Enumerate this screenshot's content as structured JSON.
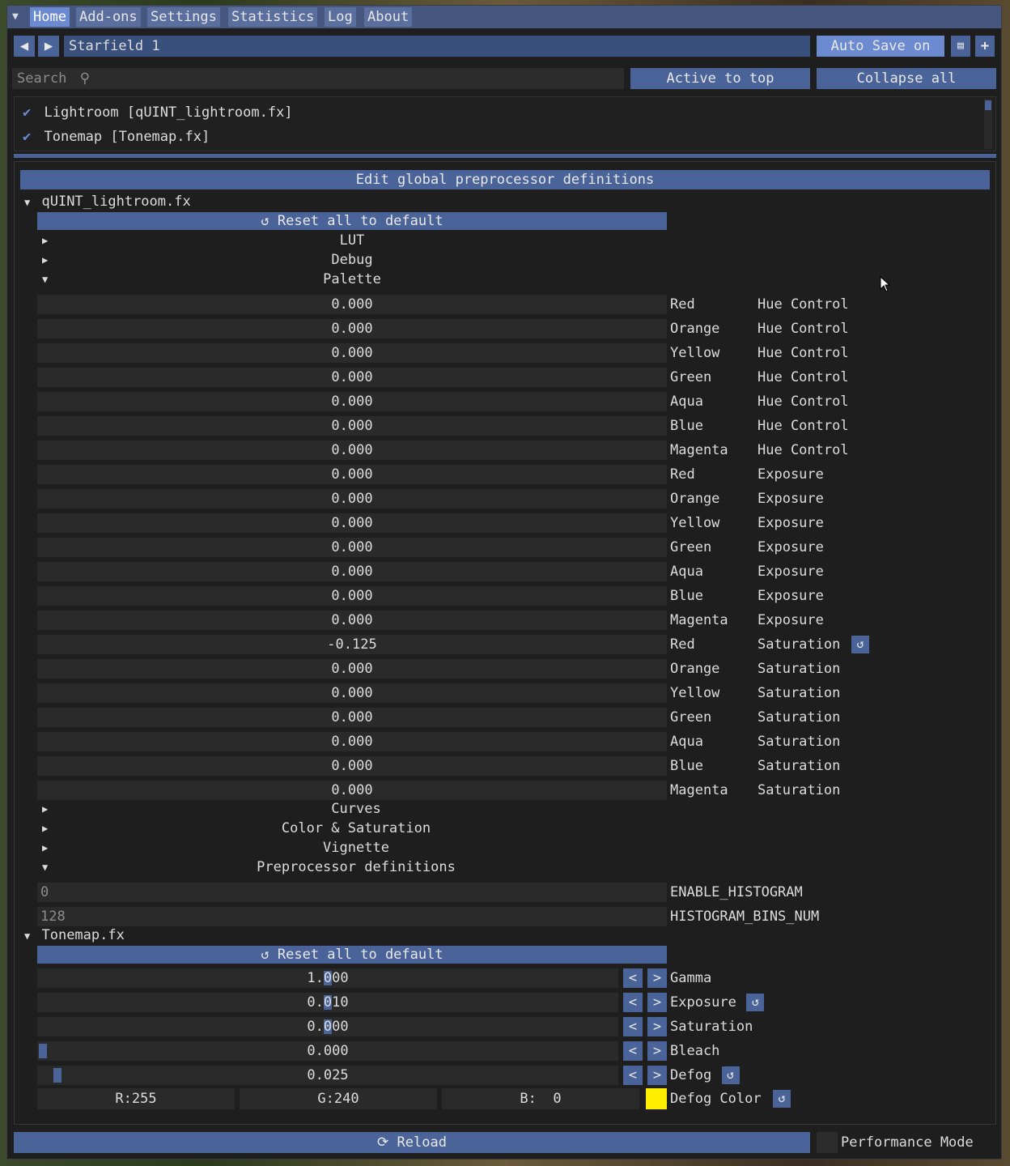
{
  "menu": {
    "items": [
      "Home",
      "Add-ons",
      "Settings",
      "Statistics",
      "Log",
      "About"
    ]
  },
  "toolbar": {
    "preset_name": "Starfield 1",
    "autosave_label": "Auto Save on"
  },
  "search": {
    "placeholder": "Search",
    "active_to_top": "Active to top",
    "collapse_all": "Collapse all"
  },
  "effects": [
    {
      "label": "Lightroom [qUINT_lightroom.fx]",
      "checked": true
    },
    {
      "label": "Tonemap [Tonemap.fx]",
      "checked": true
    }
  ],
  "global_button": "Edit global preprocessor definitions",
  "lightroom": {
    "title": "qUINT_lightroom.fx",
    "reset_label": "Reset all to default",
    "categories_top": [
      "LUT",
      "Debug",
      "Palette"
    ],
    "params": [
      {
        "value": "0.000",
        "a": "Red",
        "b": "Hue Control"
      },
      {
        "value": "0.000",
        "a": "Orange",
        "b": "Hue Control"
      },
      {
        "value": "0.000",
        "a": "Yellow",
        "b": "Hue Control"
      },
      {
        "value": "0.000",
        "a": "Green",
        "b": "Hue Control"
      },
      {
        "value": "0.000",
        "a": "Aqua",
        "b": "Hue Control"
      },
      {
        "value": "0.000",
        "a": "Blue",
        "b": "Hue Control"
      },
      {
        "value": "0.000",
        "a": "Magenta",
        "b": "Hue Control"
      },
      {
        "value": "0.000",
        "a": "Red",
        "b": "Exposure"
      },
      {
        "value": "0.000",
        "a": "Orange",
        "b": "Exposure"
      },
      {
        "value": "0.000",
        "a": "Yellow",
        "b": "Exposure"
      },
      {
        "value": "0.000",
        "a": "Green",
        "b": "Exposure"
      },
      {
        "value": "0.000",
        "a": "Aqua",
        "b": "Exposure"
      },
      {
        "value": "0.000",
        "a": "Blue",
        "b": "Exposure"
      },
      {
        "value": "0.000",
        "a": "Magenta",
        "b": "Exposure"
      },
      {
        "value": "-0.125",
        "a": "Red",
        "b": "Saturation",
        "modified": true
      },
      {
        "value": "0.000",
        "a": "Orange",
        "b": "Saturation"
      },
      {
        "value": "0.000",
        "a": "Yellow",
        "b": "Saturation"
      },
      {
        "value": "0.000",
        "a": "Green",
        "b": "Saturation"
      },
      {
        "value": "0.000",
        "a": "Aqua",
        "b": "Saturation"
      },
      {
        "value": "0.000",
        "a": "Blue",
        "b": "Saturation"
      },
      {
        "value": "0.000",
        "a": "Magenta",
        "b": "Saturation"
      }
    ],
    "categories_bottom": [
      "Curves",
      "Color & Saturation",
      "Vignette",
      "Preprocessor definitions"
    ],
    "definitions": [
      {
        "value": "0",
        "name": "ENABLE_HISTOGRAM"
      },
      {
        "value": "128",
        "name": "HISTOGRAM_BINS_NUM"
      }
    ]
  },
  "tonemap": {
    "title": "Tonemap.fx",
    "reset_label": "Reset all to default",
    "params": [
      {
        "value": "1.000",
        "name": "Gamma",
        "modified": false,
        "slider_fraction": 0.5
      },
      {
        "value": "0.010",
        "name": "Exposure",
        "modified": true,
        "slider_fraction": 0.5
      },
      {
        "value": "0.000",
        "name": "Saturation",
        "modified": false,
        "slider_fraction": 0.5
      },
      {
        "value": "0.000",
        "name": "Bleach",
        "modified": false,
        "slider_fraction": 0.0
      },
      {
        "value": "0.025",
        "name": "Defog",
        "modified": true,
        "slider_fraction": 0.025
      }
    ],
    "defog_color": {
      "r": "R:255",
      "g": "G:240",
      "b": "B:  0",
      "name": "Defog Color",
      "swatch": "#ffee00"
    },
    "step_left": "<",
    "step_right": ">"
  },
  "footer": {
    "reload_label": "Reload",
    "performance_mode": "Performance Mode"
  },
  "colors": {
    "accent": "#6b8ad0",
    "button": "#4a6399",
    "window_bg": "#1e1e1e",
    "field_bg": "#2a2a2a"
  }
}
